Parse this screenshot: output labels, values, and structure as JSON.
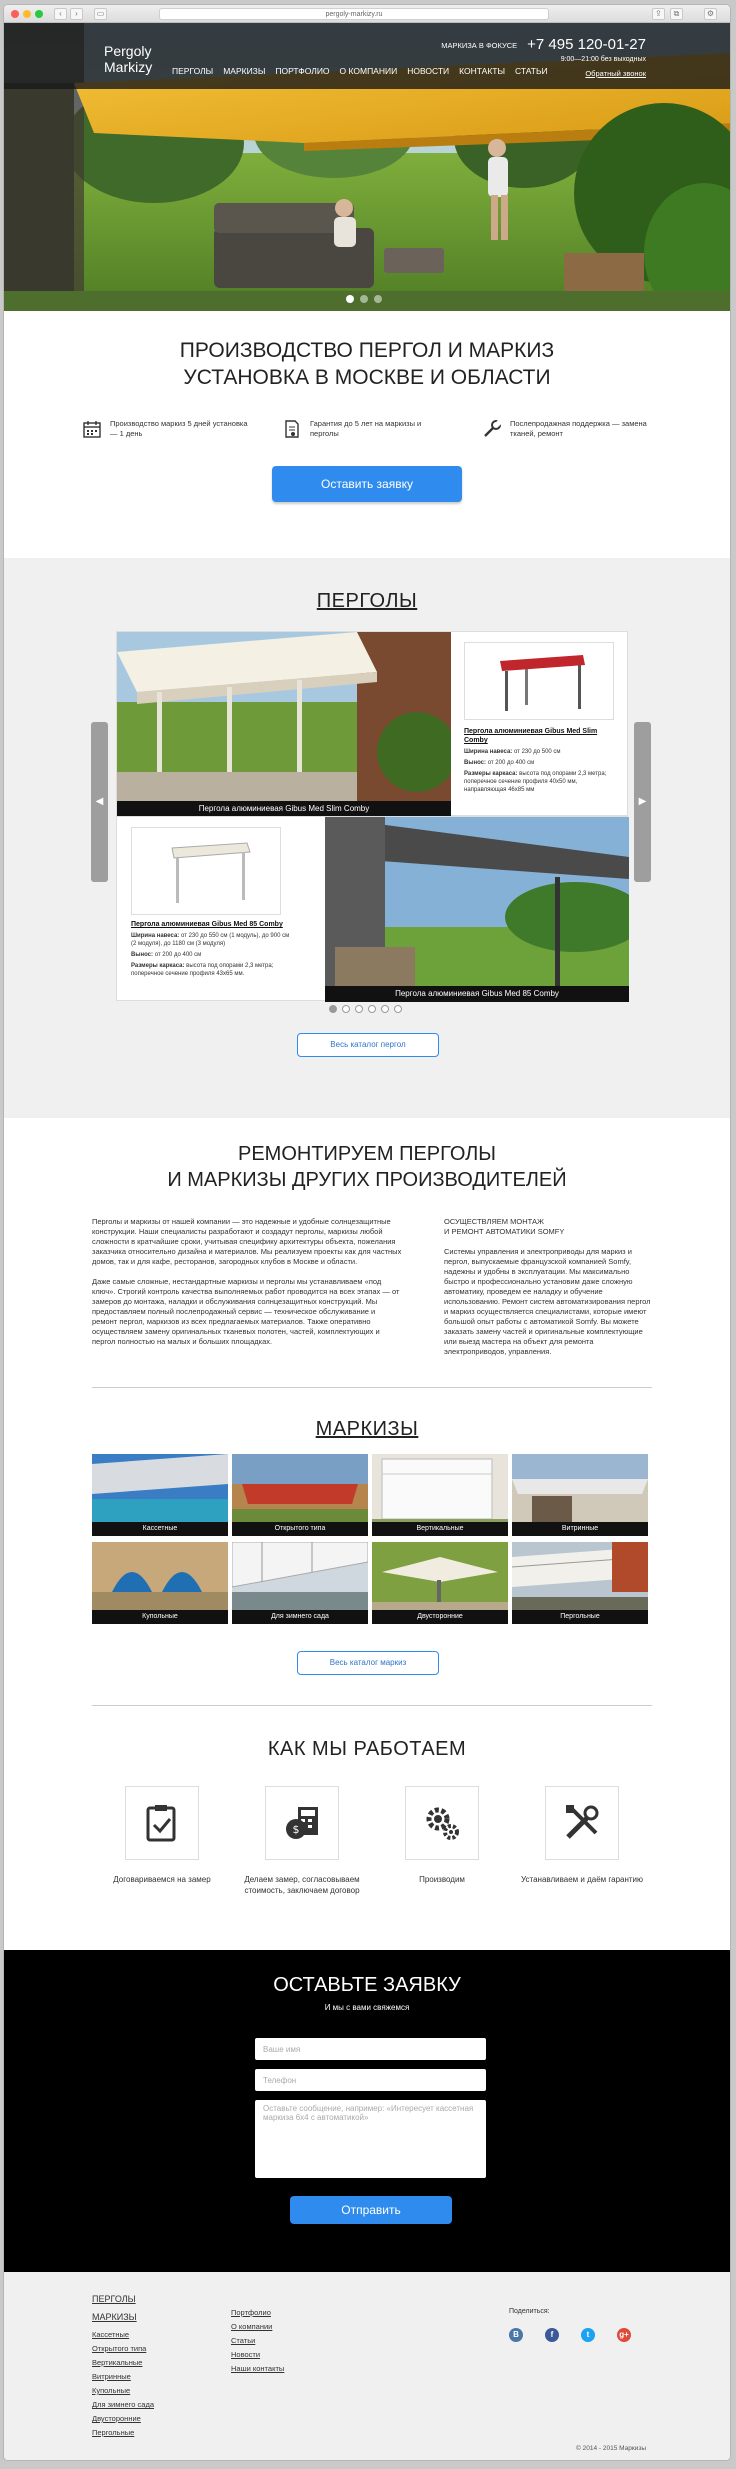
{
  "browser": {
    "url": "pergoly-markizy.ru"
  },
  "header": {
    "logo_line1": "Pergoly",
    "logo_line2": "Markizy",
    "nav": [
      "ПЕРГОЛЫ",
      "МАРКИЗЫ",
      "ПОРТФОЛИО",
      "О КОМПАНИИ",
      "НОВОСТИ",
      "КОНТАКТЫ",
      "СТАТЬИ"
    ],
    "focus": "МАРКИЗА В ФОКУСЕ",
    "phone": "+7 495 120-01-27",
    "hours": "9:00—21:00 без выходных",
    "callback": "Обратный звонок"
  },
  "intro": {
    "title_line1": "ПРОИЗВОДСТВО ПЕРГОЛ И МАРКИЗ",
    "title_line2": "УСТАНОВКА В МОСКВЕ И ОБЛАСТИ",
    "features": [
      {
        "icon": "calendar-icon",
        "text": "Производство маркиз 5 дней установка — 1 день"
      },
      {
        "icon": "document-icon",
        "text": "Гарантия до 5 лет на маркизы и перголы"
      },
      {
        "icon": "wrench-icon",
        "text": "Послепродажная поддержка — замена тканей, ремонт"
      }
    ],
    "cta": "Оставить заявку"
  },
  "pergolas": {
    "title": "ПЕРГОЛЫ",
    "items": [
      {
        "caption": "Пергола алюминиевая Gibus Med Slim Comby",
        "name": "Пергола алюминиевая Gibus Med Slim Comby",
        "width_label": "Ширина навеса:",
        "width": "от 230 до 500 см",
        "depth_label": "Вынос:",
        "depth": "от 200 до 400 см",
        "frame_label": "Размеры каркаса:",
        "frame": "высота под опорами 2,3 метра; поперечное сечение профиля 40х50 мм, направляющая 46х85 мм"
      },
      {
        "caption": "Пергола алюминиевая Gibus Med 85 Comby",
        "name": "Пергола алюминиевая Gibus Med 85 Comby",
        "width_label": "Ширина навеса:",
        "width": "от 230 до 550 см (1 модуль), до 900 см (2 модуля), до 1180 см (3 модуля)",
        "depth_label": "Вынос:",
        "depth": "от 200 до 400 см",
        "frame_label": "Размеры каркаса:",
        "frame": "высота под опорами 2,3 метра; поперечное сечение профиля 43х65 мм."
      }
    ],
    "catalog": "Весь каталог пергол"
  },
  "repair": {
    "title_line1": "РЕМОНТИРУЕМ ПЕРГОЛЫ",
    "title_line2": "И МАРКИЗЫ ДРУГИХ ПРОИЗВОДИТЕЛЕЙ",
    "left_p1": "Перголы и маркизы от нашей компании — это надежные и удобные солнцезащитные конструкции. Наши специалисты разработают и создадут перголы, маркизы любой сложности в кратчайшие сроки, учитывая специфику архитектуры объекта, пожелания заказчика относительно дизайна и материалов. Мы реализуем проекты как для частных домов, так и для кафе, ресторанов, загородных клубов в Москве и области.",
    "left_p2": "Даже самые сложные, нестандартные маркизы и перголы мы устанавливаем «под ключ». Строгий контроль качества выполняемых работ проводится на всех этапах — от замеров до монтажа, наладки и обслуживания солнцезащитных конструкций. Мы предоставляем полный послепродажный сервис — техническое обслуживание и ремонт пергол, маркизов из всех предлагаемых материалов. Также оперативно осуществляем замену оригинальных тканевых полотен, частей, комплектующих и пергол полностью на малых и больших площадках.",
    "right_head1": "ОСУЩЕСТВЛЯЕМ МОНТАЖ",
    "right_head2": "И РЕМОНТ АВТОМАТИКИ SOMFY",
    "right_p": "Системы управления и электроприводы для маркиз и пергол, выпускаемые французской компанией Somfy, надежны и удобны в эксплуатации. Мы максимально быстро и профессионально установим даже сложную автоматику, проведем ее наладку и обучение использованию. Ремонт систем автоматизирования пергол и маркиз осуществляется специалистами, которые имеют большой опыт работы с автоматикой Somfy. Вы можете заказать замену частей и оригинальные комплектующие или выезд мастера на объект для ремонта электроприводов, управления."
  },
  "markizy": {
    "title": "МАРКИЗЫ",
    "items": [
      "Кассетные",
      "Открытого типа",
      "Вертикальные",
      "Витринные",
      "Купольные",
      "Для зимнего сада",
      "Двусторонние",
      "Пергольные"
    ],
    "catalog": "Весь каталог маркиз"
  },
  "how": {
    "title": "КАК МЫ РАБОТАЕМ",
    "steps": [
      {
        "icon": "clipboard-check-icon",
        "text": "Договариваемся на замер"
      },
      {
        "icon": "calculator-money-icon",
        "text": "Делаем замер, согласовываем стоимость, заключаем договор"
      },
      {
        "icon": "gears-icon",
        "text": "Производим"
      },
      {
        "icon": "tools-icon",
        "text": "Устанавливаем и даём гарантию"
      }
    ]
  },
  "form": {
    "title": "ОСТАВЬТЕ ЗАЯВКУ",
    "subtitle": "И мы с вами свяжемся",
    "name_ph": "Ваше имя",
    "phone_ph": "Телефон",
    "msg_ph": "Оставьте сообщение, например: «Интересует кассетная маркиза 6х4 с автоматикой»",
    "submit": "Отправить"
  },
  "footer": {
    "col1_head1": "ПЕРГОЛЫ",
    "col1_head2": "МАРКИЗЫ",
    "col1": [
      "Кассетные",
      "Открытого типа",
      "Вертикальные",
      "Витринные",
      "Купольные",
      "Для зимнего сада",
      "Двусторонние",
      "Пергольные"
    ],
    "col2": [
      "Портфолио",
      "О компании",
      "Статьи",
      "Новости",
      "Наши контакты"
    ],
    "share": "Поделиться:",
    "social": [
      {
        "label": "В",
        "color": "#4a76a8",
        "icon": "vk-icon"
      },
      {
        "label": "f",
        "color": "#3b5998",
        "icon": "facebook-icon"
      },
      {
        "label": "t",
        "color": "#1da1f2",
        "icon": "twitter-icon"
      },
      {
        "label": "g+",
        "color": "#dd4b39",
        "icon": "gplus-icon"
      }
    ],
    "copyright": "© 2014 - 2015 Маркизы"
  }
}
